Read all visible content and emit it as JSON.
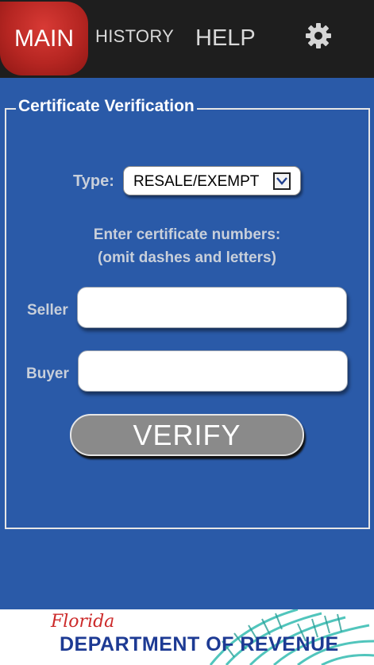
{
  "nav": {
    "main_label": "MAIN",
    "history_label": "HISTORY",
    "help_label": "HELP",
    "settings_icon": "gear-icon"
  },
  "form": {
    "legend": "Certificate Verification",
    "type_label": "Type:",
    "type_selected": "RESALE/EXEMPT",
    "instructions_line1": "Enter certificate numbers:",
    "instructions_line2": "(omit dashes and letters)",
    "seller_label": "Seller",
    "seller_value": "",
    "buyer_label": "Buyer",
    "buyer_value": "",
    "verify_label": "VERIFY"
  },
  "banner": {
    "script_text": "Florida",
    "main_text": "DEPARTMENT OF REVENUE"
  },
  "colors": {
    "background": "#2a5aa8",
    "topbar": "#1e1e1e",
    "active_tab": "#b62622",
    "button": "#8a8a8a",
    "brand_red": "#cc2a2a",
    "brand_blue": "#1d3a93"
  }
}
